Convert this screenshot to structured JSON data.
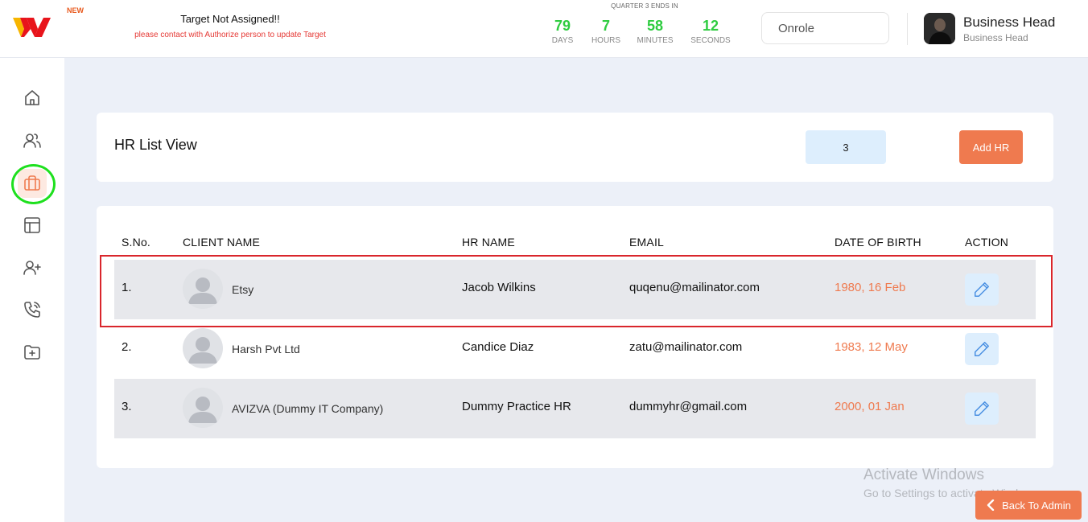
{
  "header": {
    "logo_badge": "NEW",
    "target_title": "Target Not Assigned!!",
    "target_message": "please contact with Authorize person to update Target",
    "quarter_label": "QUARTER 3 ENDS IN",
    "countdown": [
      {
        "value": "79",
        "label": "DAYS"
      },
      {
        "value": "7",
        "label": "HOURS"
      },
      {
        "value": "58",
        "label": "MINUTES"
      },
      {
        "value": "12",
        "label": "SECONDS"
      }
    ],
    "role_select_value": "Onrole",
    "user": {
      "name": "Business Head",
      "role": "Business Head"
    }
  },
  "sidebar": {
    "items": [
      {
        "name": "home",
        "icon": "home-icon",
        "active": false
      },
      {
        "name": "users",
        "icon": "users-icon",
        "active": false
      },
      {
        "name": "hr",
        "icon": "briefcase-icon",
        "active": true
      },
      {
        "name": "layout",
        "icon": "layout-icon",
        "active": false
      },
      {
        "name": "add-user",
        "icon": "user-plus-icon",
        "active": false
      },
      {
        "name": "calls",
        "icon": "phone-call-icon",
        "active": false
      },
      {
        "name": "folder",
        "icon": "folder-plus-icon",
        "active": false
      }
    ]
  },
  "page": {
    "title": "HR List View",
    "count": "3",
    "add_button_label": "Add HR"
  },
  "table": {
    "columns": [
      "S.No.",
      "CLIENT NAME",
      "HR NAME",
      "EMAIL",
      "DATE OF BIRTH",
      "ACTION"
    ],
    "rows": [
      {
        "sno": "1.",
        "client": "Etsy",
        "hr_name": "Jacob Wilkins",
        "email": "quqenu@mailinator.com",
        "dob": "1980, 16 Feb"
      },
      {
        "sno": "2.",
        "client": "Harsh Pvt Ltd",
        "hr_name": "Candice Diaz",
        "email": "zatu@mailinator.com",
        "dob": "1983, 12 May"
      },
      {
        "sno": "3.",
        "client": "AVIZVA (Dummy IT Company)",
        "hr_name": "Dummy Practice HR",
        "email": "dummyhr@gmail.com",
        "dob": "2000, 01 Jan"
      }
    ]
  },
  "watermark": {
    "title": "Activate Windows",
    "subtitle": "Go to Settings to activate Windows."
  },
  "back_button_label": "Back To Admin",
  "colors": {
    "accent": "#ef7a4f",
    "countdown": "#2ecc40",
    "alert": "#e53935",
    "edit": "#4a90e2",
    "highlight": "#d9262c",
    "annotation_ring": "#1ee01e"
  }
}
